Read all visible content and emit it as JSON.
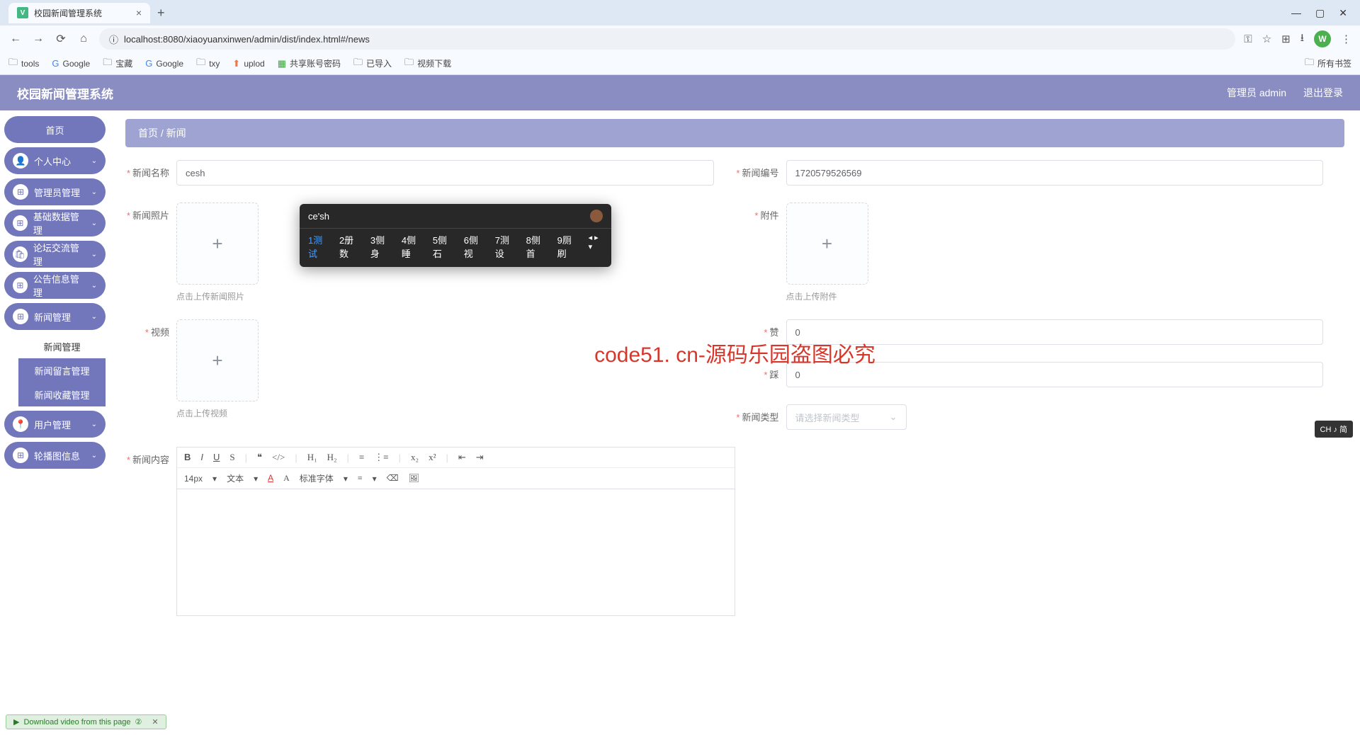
{
  "browser": {
    "tab_title": "校园新闻管理系统",
    "url": "localhost:8080/xiaoyuanxinwen/admin/dist/index.html#/news",
    "profile_letter": "W",
    "bookmarks": [
      "tools",
      "Google",
      "宝藏",
      "Google",
      "txy",
      "uplod",
      "共享账号密码",
      "已导入",
      "视频下载"
    ],
    "all_bookmarks": "所有书签"
  },
  "header": {
    "title": "校园新闻管理系统",
    "user_label": "管理员 admin",
    "logout": "退出登录"
  },
  "sidebar": {
    "home": "首页",
    "items": [
      {
        "label": "个人中心"
      },
      {
        "label": "管理员管理"
      },
      {
        "label": "基础数据管理"
      },
      {
        "label": "论坛交流管理"
      },
      {
        "label": "公告信息管理"
      },
      {
        "label": "新闻管理"
      }
    ],
    "submenu": {
      "active": "新闻管理",
      "item1": "新闻留言管理",
      "item2": "新闻收藏管理"
    },
    "after": [
      {
        "label": "用户管理"
      },
      {
        "label": "轮播图信息"
      }
    ]
  },
  "breadcrumb": {
    "home": "首页",
    "current": "新闻"
  },
  "form": {
    "news_name": {
      "label": "新闻名称",
      "value": "cesh"
    },
    "news_code": {
      "label": "新闻编号",
      "value": "1720579526569"
    },
    "news_photo": {
      "label": "新闻照片",
      "hint": "点击上传新闻照片"
    },
    "attachment": {
      "label": "附件",
      "hint": "点击上传附件"
    },
    "video": {
      "label": "视频",
      "hint": "点击上传视频"
    },
    "like": {
      "label": "赞",
      "value": "0"
    },
    "dislike": {
      "label": "踩",
      "value": "0"
    },
    "news_type": {
      "label": "新闻类型",
      "placeholder": "请选择新闻类型"
    },
    "news_content": {
      "label": "新闻内容"
    }
  },
  "editor": {
    "font_size": "14px",
    "font_type": "文本",
    "font_family": "标准字体"
  },
  "ime": {
    "input": "ce'sh",
    "candidates": [
      "1测试",
      "2册数",
      "3侧身",
      "4侧睡",
      "5侧石",
      "6侧视",
      "7测设",
      "8侧首",
      "9厕刷"
    ]
  },
  "watermark": "code51. cn-源码乐园盗图必究",
  "download_banner": "Download video from this page",
  "lang_badge": "CH ♪ 简"
}
